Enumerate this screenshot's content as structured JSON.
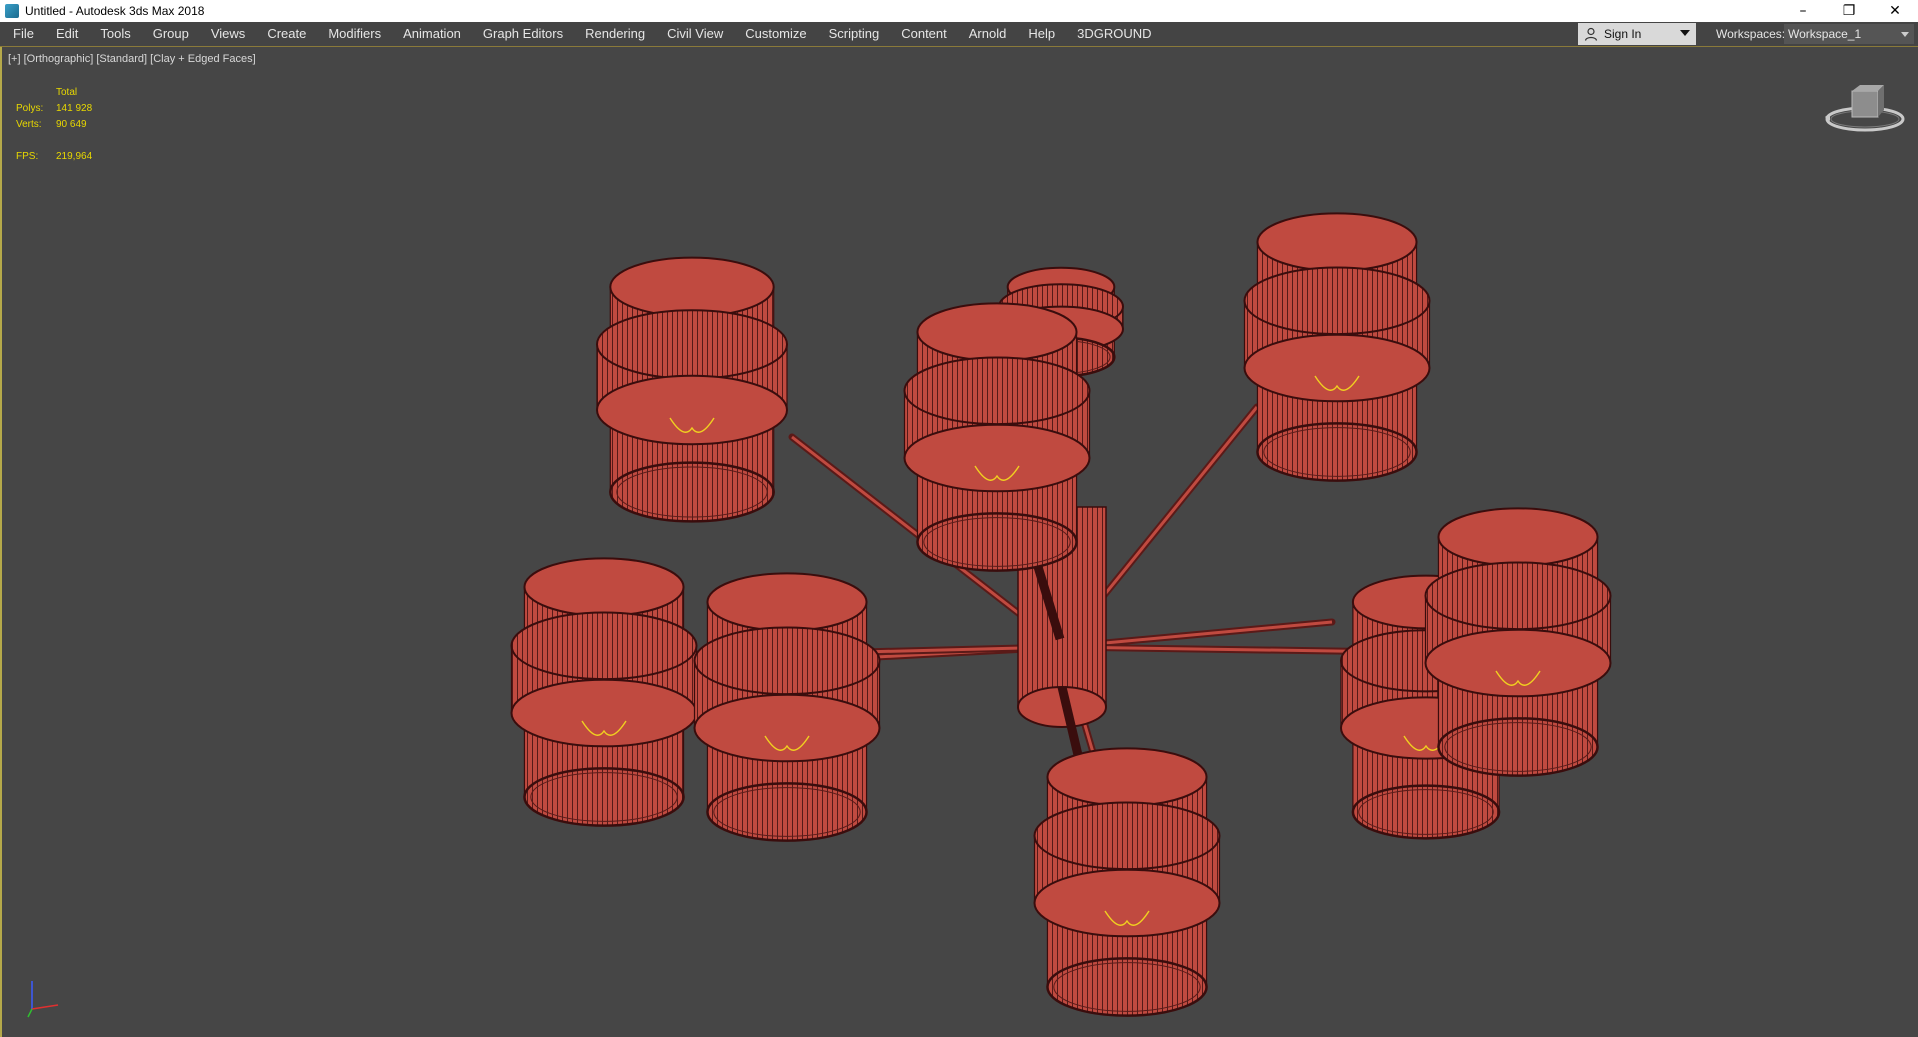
{
  "window": {
    "title": "Untitled - Autodesk 3ds Max 2018",
    "controls": [
      "minimize",
      "restore",
      "close"
    ]
  },
  "menubar": {
    "items": [
      "File",
      "Edit",
      "Tools",
      "Group",
      "Views",
      "Create",
      "Modifiers",
      "Animation",
      "Graph Editors",
      "Rendering",
      "Civil View",
      "Customize",
      "Scripting",
      "Content",
      "Arnold",
      "Help",
      "3DGROUND"
    ],
    "sign_in": "Sign In",
    "workspaces_label": "Workspaces:",
    "workspace_value": "Workspace_1"
  },
  "viewport": {
    "label": "[+] [Orthographic] [Standard] [Clay + Edged Faces]",
    "stats": {
      "header": "Total",
      "polys_label": "Polys:",
      "polys_value": "141 928",
      "verts_label": "Verts:",
      "verts_value": "90 649",
      "fps_label": "FPS:",
      "fps_value": "219,964"
    }
  },
  "colors": {
    "mesh_fill": "#c04a40",
    "mesh_edge": "#3a0d0d",
    "filament": "#f0d020",
    "viewport_bg": "#464646",
    "active_border": "#b5a94a"
  },
  "icons": {
    "user": "user-icon",
    "viewcube": "viewcube-icon",
    "axis": "axis-tripod-icon"
  }
}
